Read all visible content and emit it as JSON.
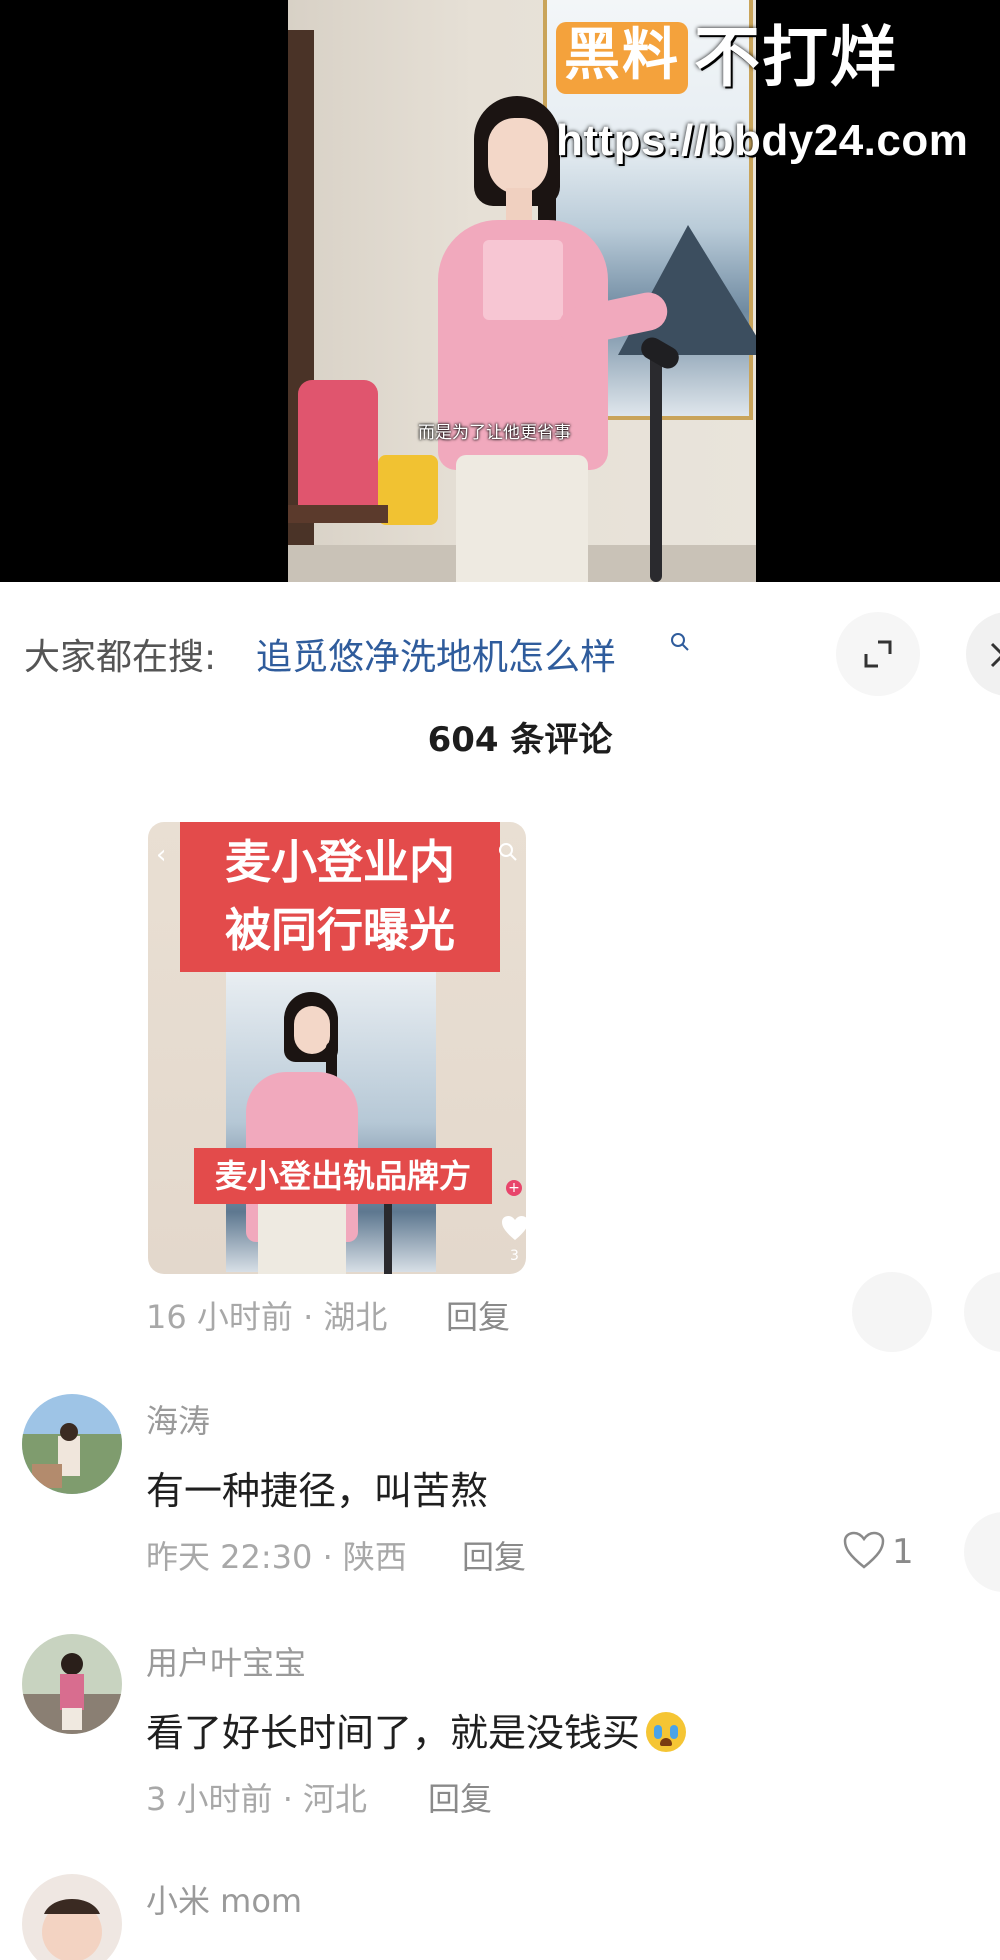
{
  "video": {
    "subtitle": "而是为了让他更省事",
    "watermark_badge": "黑料",
    "watermark_text": "不打烊",
    "watermark_url": "https://bbdy24.com"
  },
  "search": {
    "label": "大家都在搜:",
    "query": "追觅悠净洗地机怎么样"
  },
  "comments_header": {
    "count_text": "604 条评论"
  },
  "image_comment": {
    "thumbnail_title": "麦小登业内\n被同行曝光",
    "thumbnail_caption": "麦小登出轨品牌方",
    "thumbnail_side_count": "3",
    "meta": "16 小时前 · 湖北",
    "reply": "回复"
  },
  "comments": [
    {
      "username": "海涛",
      "text": "有一种捷径，叫苦熬",
      "meta": "昨天 22:30 · 陕西",
      "reply": "回复",
      "likes": "1"
    },
    {
      "username": "用户叶宝宝",
      "text": "看了好长时间了，就是没钱买",
      "meta": "3 小时前 · 河北",
      "reply": "回复"
    },
    {
      "username": "小米 mom",
      "text": ""
    }
  ],
  "colors": {
    "query_blue": "#2f5c9c",
    "watermark_orange": "#f4a23c",
    "thumb_red": "#e34b4b"
  }
}
